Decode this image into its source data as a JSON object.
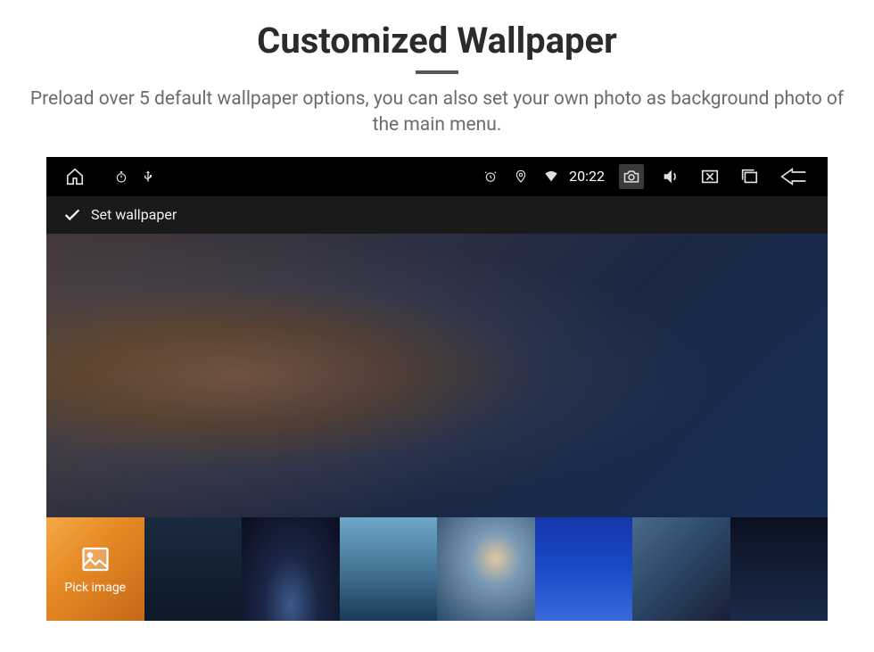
{
  "page": {
    "title": "Customized Wallpaper",
    "subtitle": "Preload over 5 default wallpaper options, you can also set your own photo as background photo of the main menu."
  },
  "statusBar": {
    "time": "20:22"
  },
  "actionBar": {
    "label": "Set wallpaper"
  },
  "thumbnails": {
    "pickImage": "Pick image"
  },
  "icons": {
    "home": "home-icon",
    "stopwatch": "stopwatch-icon",
    "usb": "usb-icon",
    "alarm": "alarm-icon",
    "location": "location-icon",
    "wifi": "wifi-icon",
    "camera": "camera-icon",
    "volume": "volume-icon",
    "close": "close-icon",
    "recent": "recent-apps-icon",
    "back": "back-icon",
    "check": "check-icon",
    "image": "image-icon"
  }
}
